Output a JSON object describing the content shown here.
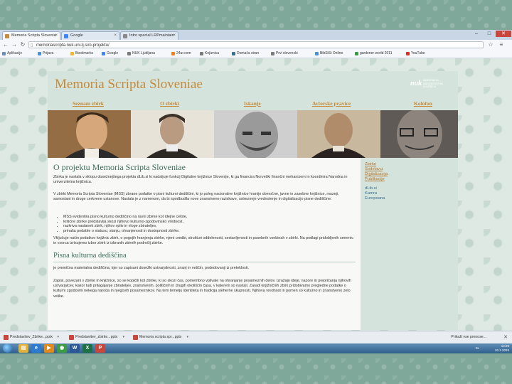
{
  "browser": {
    "tabs": [
      {
        "label": "Memoria Scripta Slovenia",
        "active": true,
        "favicon_color": "#c58a3a"
      },
      {
        "label": "Google",
        "active": false,
        "favicon_color": "#4285f4"
      },
      {
        "label": "Intro special LRPmaintain",
        "active": false,
        "favicon_color": "#8a8a8a"
      }
    ],
    "window_controls": {
      "minimize": "–",
      "maximize": "□",
      "close": "✕"
    },
    "url": "memoriascripta.nuk.uni-lj.si/o-projektu/",
    "bookmarks": [
      {
        "label": "Aplikacije",
        "color": "#6b8cba"
      },
      {
        "label": "Prijava",
        "color": "#4a90d9"
      },
      {
        "label": "Bookmarks",
        "color": "#f2b632"
      },
      {
        "label": "Google",
        "color": "#4285f4"
      },
      {
        "label": "NUK Ljubljana",
        "color": "#7a7a7a"
      },
      {
        "label": "24ur.com",
        "color": "#f07f1b"
      },
      {
        "label": "Knjiznica",
        "color": "#7a7a7a"
      },
      {
        "label": "Domača stran",
        "color": "#3b6f8f"
      },
      {
        "label": "Prvi slovenski",
        "color": "#7a7a7a"
      },
      {
        "label": "BibSiSt Online",
        "color": "#4a90d9"
      },
      {
        "label": "gardener world 2011",
        "color": "#3a9a4a"
      },
      {
        "label": "YouTube",
        "color": "#d93025"
      }
    ]
  },
  "site": {
    "title": "Memoria Scripta Sloveniae",
    "logo_mark": "nuk",
    "logo_text": "NARODNA IN UNIVERZITETNA KNJIŽNICA",
    "nav": [
      "Seznam zbirk",
      "O zbirki",
      "Iskanje",
      "Avtorske pravice",
      "Kolofon"
    ],
    "heading": "O projektu Memoria Scripta Sloveniae",
    "paragraphs": [
      "Zbirka je nastala v sklopu dosežnejšega projekta dLib.si ki nadaljuje funkcij Digitalne knjižnice Slovenije, ki ga financira Norveški finančni mehanizem in koordinira Narodna in univerzitetna knjižnica.",
      "V zbirki Memoria Scripta Sloveniae (MSS) zbrane podatke o pisni kulturni dediščini, ki jo poleg nacionalne knjižnice hranijo območne, javne in zasebne knjižnice, muzeji, samostani in druge cerkvene ustanove. Nastala je z namenom, da bi spodbudila nove znanstvene raziskave, ustrezneje vrednotenje in digitalizacijo pisne dediščine."
    ],
    "bullets": [
      "MSS evidentira pisno kulturno dediščino na ravni zbirke kot idejne celote,",
      "kritične zbirke predstavlja skozi njihovo kulturno-zgodovinsko vrednost,",
      "razkriva nastanek zbirk, njihov vpliv in vloge zbirateljev,",
      "prinaša podatke o statusu, stanju, ohranjenosti in dostopnosti zbirke."
    ],
    "closing": "Vključuje način podatkov knjižnic zbirk, o pogojih hranjenja zbirke, njeni uredbi, strukturi oddelenosti, sestavljenosti in posebnih vsebinah v zbirki. Na podlagi pridobljenih smernic in vzorca izrisujemo izbor zbirk iz izbranih zbirnih področij zbirke.",
    "subheading": "Pisna kulturna dediščina",
    "sub_paragraphs": [
      "je premična materialna dediščina, kjer so zapisani dosežki ustvarjalnosti, znanj in veščin, podedovanji iz preteklosti.",
      "Zapisi, povezani v zbirke in knjižnice, so se kopičili kot zbirke, ki so skozi čas, pomembno vplivale na ohranjanje posameznih delov. Izražajo ideje, nazore in prepričanja njihovih ustvarjalcev, kakor tudi prilagajanje zbirateljev, znanstvenih, političnih in drugih okoliščin časa, v katerem so nastali. Zaradi knjižničnih zbirk pridobivamo pregledne podatke o kulturni zgodovini nekega naroda in njegovih posameznikov. Na tem temelju identiteta in tradicija sleherne skupnosti. Njihova vrednost in pomen so kulturno in znanstveno zelo velike."
    ],
    "sidebar_links": [
      {
        "label": "Zbirke",
        "style": "a"
      },
      {
        "label": "Sodelavci",
        "style": "a"
      },
      {
        "label": "Digitalizacija",
        "style": "a"
      },
      {
        "label": "Publikacije",
        "style": "a"
      },
      {
        "label": "dLib.si",
        "style": "b"
      },
      {
        "label": "Kamra",
        "style": "b"
      },
      {
        "label": "Europeana",
        "style": "b"
      }
    ]
  },
  "downloads": {
    "items": [
      "Predstavitev_Zbirke...pptx",
      "Predstavitev_zbirke...pptx",
      "Memoria scripta spr...pptx"
    ],
    "show_all": "Prikaži vse prenose...",
    "close": "✕"
  },
  "taskbar": {
    "apps": [
      {
        "name": "explorer-icon",
        "color": "#e0b341",
        "glyph": "▤"
      },
      {
        "name": "ie-icon",
        "color": "#2c7bd1",
        "glyph": "e"
      },
      {
        "name": "media-icon",
        "color": "#e08a1e",
        "glyph": "▶"
      },
      {
        "name": "chrome-icon",
        "color": "#3d9c45",
        "glyph": "◉"
      },
      {
        "name": "word-icon",
        "color": "#2b5797",
        "glyph": "W"
      },
      {
        "name": "excel-icon",
        "color": "#1e7145",
        "glyph": "X"
      },
      {
        "name": "powerpoint-icon",
        "color": "#c9473a",
        "glyph": "P"
      }
    ],
    "lang": "SL",
    "time": "14:29",
    "date": "20.1.2015"
  }
}
